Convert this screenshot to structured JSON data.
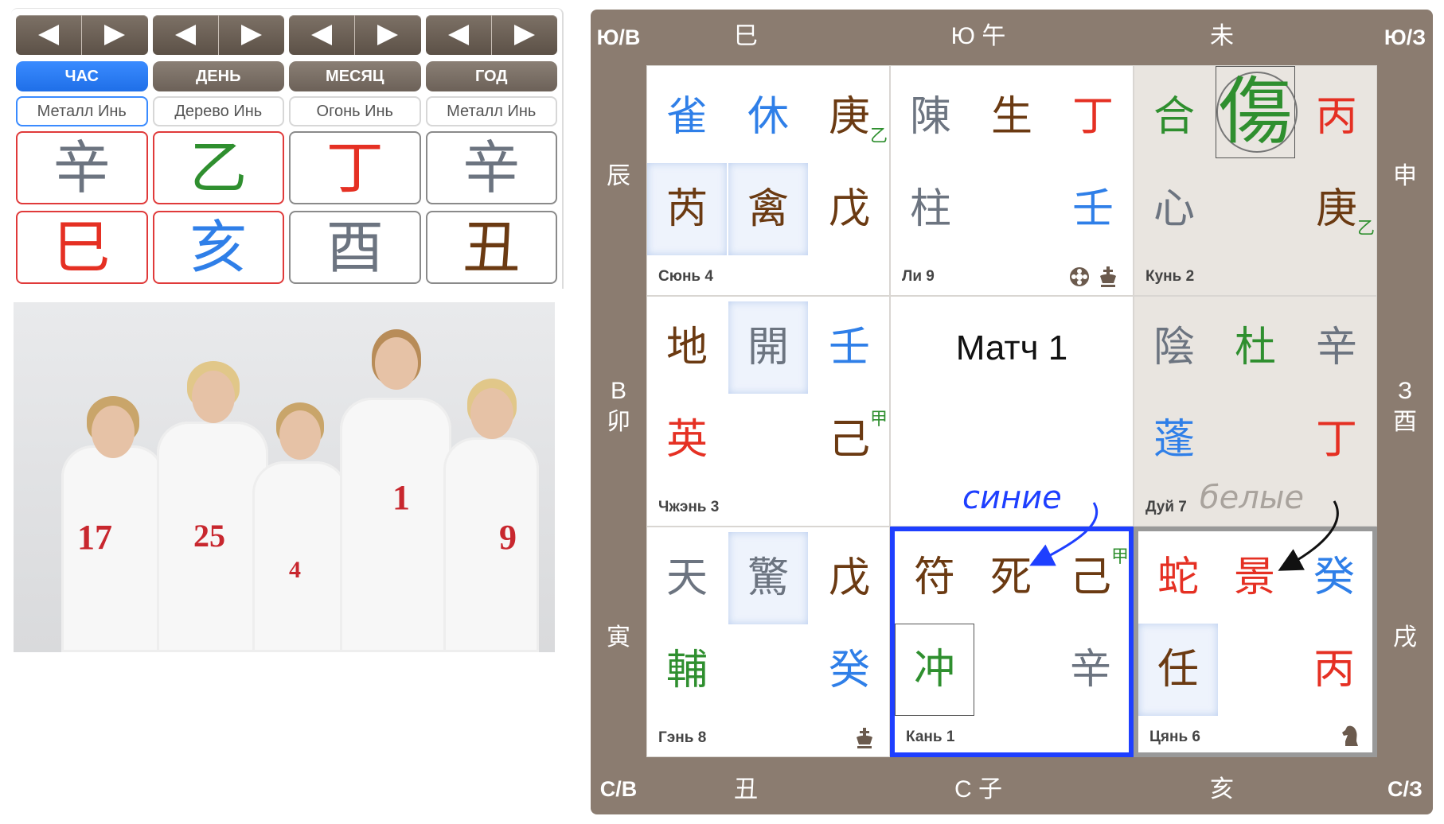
{
  "pillar_panel": {
    "tabs": [
      {
        "label": "ЧАС",
        "active": true
      },
      {
        "label": "ДЕНЬ",
        "active": false
      },
      {
        "label": "МЕСЯЦ",
        "active": false
      },
      {
        "label": "ГОД",
        "active": false
      }
    ],
    "elements": [
      "Металл Инь",
      "Дерево Инь",
      "Огонь Инь",
      "Металл Инь"
    ],
    "stems": [
      {
        "char": "辛",
        "color": "#6c7480"
      },
      {
        "char": "乙",
        "color": "#2f8f2f"
      },
      {
        "char": "丁",
        "color": "#e53023"
      },
      {
        "char": "辛",
        "color": "#6c7480"
      }
    ],
    "branches": [
      {
        "char": "巳",
        "color": "#e53023"
      },
      {
        "char": "亥",
        "color": "#2f7fe8"
      },
      {
        "char": "酉",
        "color": "#6c7480"
      },
      {
        "char": "丑",
        "color": "#6b3a12"
      }
    ]
  },
  "photo": {
    "jersey_numbers": [
      "17",
      "25",
      "4",
      "1",
      "9"
    ]
  },
  "board": {
    "corners": {
      "nw": "Ю/В",
      "ne": "Ю/З",
      "sw": "С/В",
      "se": "С/З"
    },
    "top": [
      "巳",
      "Ю 午",
      "未"
    ],
    "bottom": [
      "丑",
      "С 子",
      "亥"
    ],
    "left": [
      "辰",
      "В\n卯",
      "寅"
    ],
    "right": [
      "申",
      "З\n酉",
      "戌"
    ],
    "center_text": "Матч 1",
    "annotations": {
      "blue": "синие",
      "white": "белые"
    },
    "palaces": {
      "xun": {
        "label": "Сюнь 4",
        "r1": [
          "雀",
          "休",
          "庚"
        ],
        "r1_sub": "乙",
        "r2": [
          "芮",
          "禽",
          "戊"
        ]
      },
      "li": {
        "label": "Ли 9",
        "r1": [
          "陳",
          "生",
          "丁"
        ],
        "r2": [
          "柱",
          "壬"
        ]
      },
      "kun": {
        "label": "Кунь 2",
        "r1": [
          "合",
          "傷",
          "丙"
        ],
        "r2": [
          "心",
          "庚"
        ],
        "r2_sub": "乙"
      },
      "zhen": {
        "label": "Чжэнь 3",
        "r1": [
          "地",
          "開",
          "壬"
        ],
        "r2": [
          "英",
          "己"
        ],
        "r2_sup": "甲"
      },
      "dui": {
        "label": "Дуй 7",
        "r1": [
          "陰",
          "杜",
          "辛"
        ],
        "r2": [
          "蓬",
          "丁"
        ]
      },
      "gen": {
        "label": "Гэнь 8",
        "r1": [
          "天",
          "驚",
          "戊"
        ],
        "r2": [
          "輔",
          "癸"
        ]
      },
      "kan": {
        "label": "Кань 1",
        "r1": [
          "符",
          "死",
          "己"
        ],
        "r1_sup": "甲",
        "r2": [
          "冲",
          "辛"
        ]
      },
      "qian": {
        "label": "Цянь 6",
        "r1": [
          "蛇",
          "景",
          "癸"
        ],
        "r2": [
          "任",
          "丙"
        ]
      }
    }
  }
}
